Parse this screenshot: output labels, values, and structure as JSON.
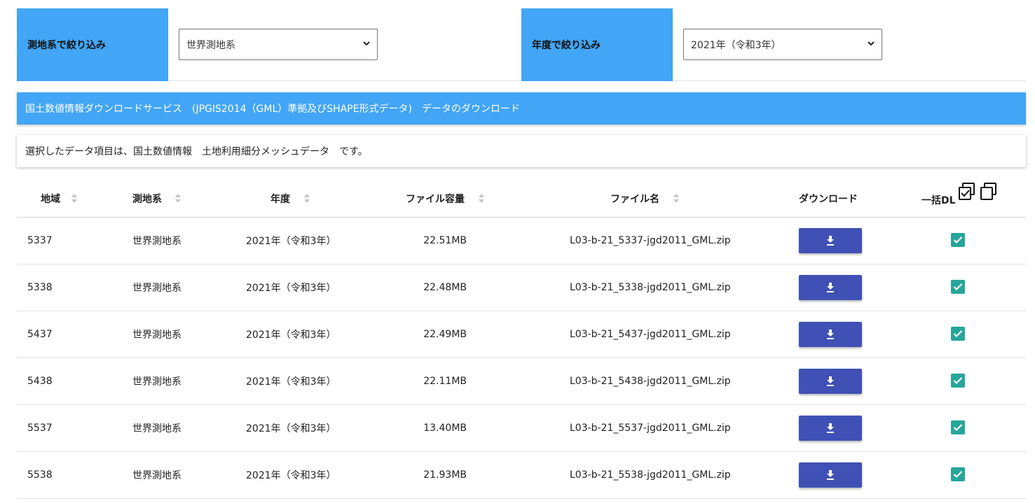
{
  "filters": {
    "datum_label": "測地系で絞り込み",
    "datum_value": "世界測地系",
    "year_label": "年度で絞り込み",
    "year_value": "2021年（令和3年）"
  },
  "banner": {
    "title": "国土数値情報ダウンロードサービス　(JPGIS2014（GML）準拠及びSHAPE形式データ)　データのダウンロード"
  },
  "notice": {
    "text": "選択したデータ項目は、国土数値情報　土地利用細分メッシュデータ　です。"
  },
  "table": {
    "headers": {
      "region": "地域",
      "datum": "測地系",
      "year": "年度",
      "size": "ファイル容量",
      "file": "ファイル名",
      "download": "ダウンロード",
      "bulk": "一括DL"
    },
    "rows": [
      {
        "region": "5337",
        "datum": "世界測地系",
        "year": "2021年（令和3年）",
        "size": "22.51MB",
        "file": "L03-b-21_5337-jgd2011_GML.zip",
        "checked": true
      },
      {
        "region": "5338",
        "datum": "世界測地系",
        "year": "2021年（令和3年）",
        "size": "22.48MB",
        "file": "L03-b-21_5338-jgd2011_GML.zip",
        "checked": true
      },
      {
        "region": "5437",
        "datum": "世界測地系",
        "year": "2021年（令和3年）",
        "size": "22.49MB",
        "file": "L03-b-21_5437-jgd2011_GML.zip",
        "checked": true
      },
      {
        "region": "5438",
        "datum": "世界測地系",
        "year": "2021年（令和3年）",
        "size": "22.11MB",
        "file": "L03-b-21_5438-jgd2011_GML.zip",
        "checked": true
      },
      {
        "region": "5537",
        "datum": "世界測地系",
        "year": "2021年（令和3年）",
        "size": "13.40MB",
        "file": "L03-b-21_5537-jgd2011_GML.zip",
        "checked": true
      },
      {
        "region": "5538",
        "datum": "世界測地系",
        "year": "2021年（令和3年）",
        "size": "21.93MB",
        "file": "L03-b-21_5538-jgd2011_GML.zip",
        "checked": true
      }
    ]
  },
  "colors": {
    "header_blue": "#42a5f5",
    "button_indigo": "#3f51b5",
    "checkbox_teal": "#26a69a"
  },
  "icons": {
    "download": "download-icon",
    "select_all": "select-all-icon",
    "deselect_all": "deselect-all-icon",
    "sort": "sort-icon",
    "checkbox": "checkbox-checked-icon"
  }
}
